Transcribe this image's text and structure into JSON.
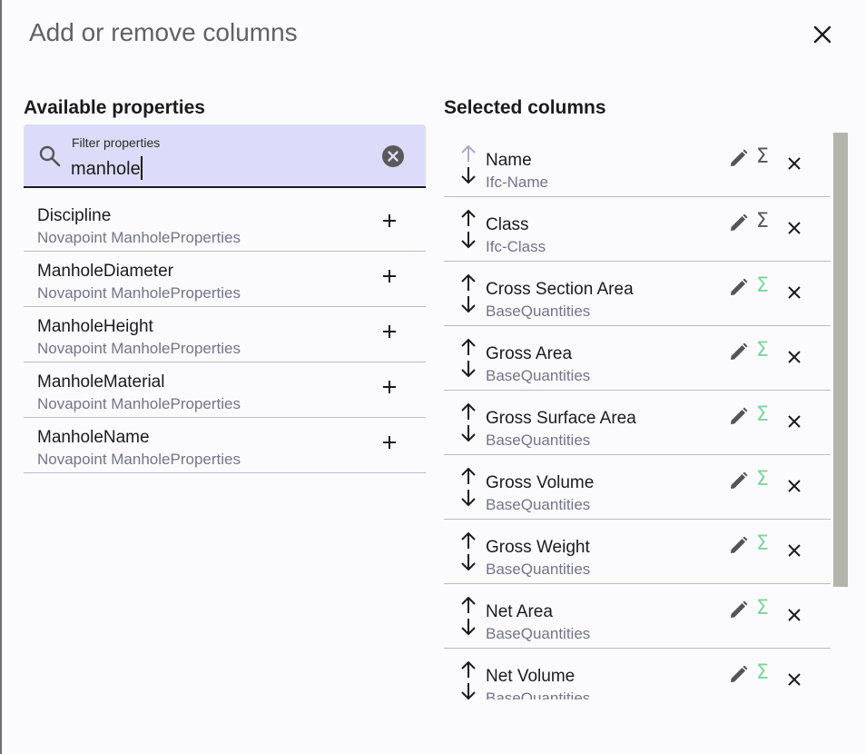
{
  "dialog": {
    "title": "Add or remove columns",
    "close_icon": "close-icon"
  },
  "available": {
    "heading": "Available properties",
    "search": {
      "label": "Filter properties",
      "value": "manhole",
      "icon": "search-icon",
      "clear_icon": "clear-circle-icon"
    },
    "items": [
      {
        "name": "Discipline",
        "source": "Novapoint ManholeProperties",
        "icon": "plus-icon"
      },
      {
        "name": "ManholeDiameter",
        "source": "Novapoint ManholeProperties",
        "icon": "plus-icon"
      },
      {
        "name": "ManholeHeight",
        "source": "Novapoint ManholeProperties",
        "icon": "plus-icon"
      },
      {
        "name": "ManholeMaterial",
        "source": "Novapoint ManholeProperties",
        "icon": "plus-icon"
      },
      {
        "name": "ManholeName",
        "source": "Novapoint ManholeProperties",
        "icon": "plus-icon"
      }
    ]
  },
  "selected": {
    "heading": "Selected columns",
    "sum_symbol": "Σ",
    "colors": {
      "sum_active": "#7cd69a",
      "sum_inactive": "#555555",
      "arrow_disabled": "#a9abc4",
      "edit": "#555555"
    },
    "items": [
      {
        "name": "Name",
        "source": "Ifc-Name",
        "up_enabled": false,
        "sum_active": false
      },
      {
        "name": "Class",
        "source": "Ifc-Class",
        "up_enabled": true,
        "sum_active": false
      },
      {
        "name": "Cross Section Area",
        "source": "BaseQuantities",
        "up_enabled": true,
        "sum_active": true
      },
      {
        "name": "Gross Area",
        "source": "BaseQuantities",
        "up_enabled": true,
        "sum_active": true
      },
      {
        "name": "Gross Surface Area",
        "source": "BaseQuantities",
        "up_enabled": true,
        "sum_active": true
      },
      {
        "name": "Gross Volume",
        "source": "BaseQuantities",
        "up_enabled": true,
        "sum_active": true
      },
      {
        "name": "Gross Weight",
        "source": "BaseQuantities",
        "up_enabled": true,
        "sum_active": true
      },
      {
        "name": "Net Area",
        "source": "BaseQuantities",
        "up_enabled": true,
        "sum_active": true
      },
      {
        "name": "Net Volume",
        "source": "BaseQuantities",
        "up_enabled": true,
        "sum_active": true
      }
    ]
  }
}
